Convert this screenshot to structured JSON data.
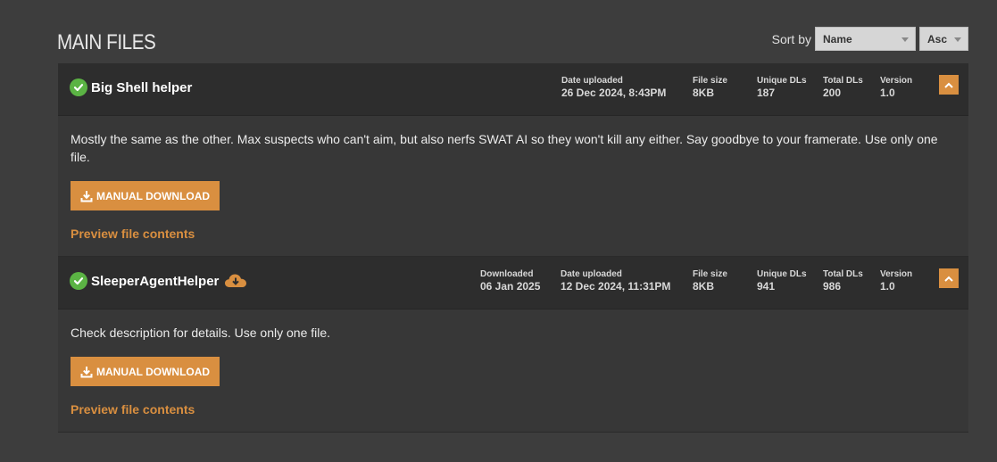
{
  "section_title": "MAIN FILES",
  "sort": {
    "label": "Sort by",
    "field_value": "Name",
    "order_value": "Asc"
  },
  "files": [
    {
      "name": "Big Shell helper",
      "downloaded_label": "",
      "downloaded_value": "",
      "date_uploaded_label": "Date uploaded",
      "date_uploaded": "26 Dec 2024, 8:43PM",
      "file_size_label": "File size",
      "file_size": "8KB",
      "unique_dls_label": "Unique DLs",
      "unique_dls": "187",
      "total_dls_label": "Total DLs",
      "total_dls": "200",
      "version_label": "Version",
      "version": "1.0",
      "description": "Mostly the same as the other. Max suspects who can't aim, but also nerfs SWAT AI so they won't kill any either. Say goodbye to your framerate. Use only one file.",
      "download_label": "MANUAL DOWNLOAD",
      "preview_label": "Preview file contents"
    },
    {
      "name": "SleeperAgentHelper",
      "downloaded_label": "Downloaded",
      "downloaded_value": "06 Jan 2025",
      "date_uploaded_label": "Date uploaded",
      "date_uploaded": "12 Dec 2024, 11:31PM",
      "file_size_label": "File size",
      "file_size": "8KB",
      "unique_dls_label": "Unique DLs",
      "unique_dls": "941",
      "total_dls_label": "Total DLs",
      "total_dls": "986",
      "version_label": "Version",
      "version": "1.0",
      "description": "Check description for details. Use only one file.",
      "download_label": "MANUAL DOWNLOAD",
      "preview_label": "Preview file contents"
    }
  ],
  "colors": {
    "accent": "#d98f40",
    "check": "#5bb344",
    "header_bg": "#2d2d2d",
    "body_bg": "#373737",
    "page_bg": "#3d3d3d"
  }
}
